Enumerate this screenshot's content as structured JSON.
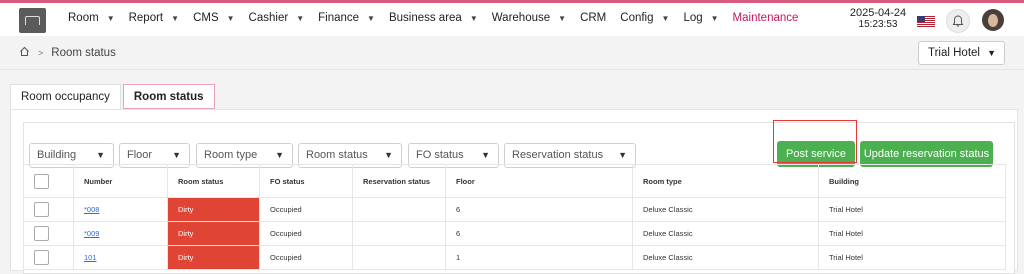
{
  "topbar": {
    "nav": [
      {
        "label": "Room",
        "dropdown": true
      },
      {
        "label": "Report",
        "dropdown": true
      },
      {
        "label": "CMS",
        "dropdown": true
      },
      {
        "label": "Cashier",
        "dropdown": true
      },
      {
        "label": "Finance",
        "dropdown": true
      },
      {
        "label": "Business area",
        "dropdown": true
      },
      {
        "label": "Warehouse",
        "dropdown": true
      },
      {
        "label": "CRM",
        "dropdown": false
      },
      {
        "label": "Config",
        "dropdown": true
      },
      {
        "label": "Log",
        "dropdown": true
      },
      {
        "label": "Maintenance",
        "dropdown": false,
        "active": true
      }
    ],
    "date": "2025-04-24",
    "time": "15:23:53",
    "accent_color": "#c2185b"
  },
  "breadcrumb": {
    "current": "Room status"
  },
  "hotel_select": {
    "value": "Trial Hotel"
  },
  "tabs": [
    {
      "label": "Room occupancy",
      "active": false
    },
    {
      "label": "Room status",
      "active": true
    }
  ],
  "filters": {
    "building": "Building",
    "floor": "Floor",
    "room_type": "Room type",
    "room_status": "Room status",
    "fo_status": "FO status",
    "reservation_status": "Reservation status"
  },
  "actions": {
    "post_service": "Post service",
    "update_reservation_status": "Update reservation status",
    "button_color": "#4caf50"
  },
  "table": {
    "headers": [
      "Number",
      "Room status",
      "FO status",
      "Reservation status",
      "Floor",
      "Room type",
      "Building"
    ],
    "rows": [
      {
        "number": "*008",
        "room_status": "Dirty",
        "fo_status": "Occupied",
        "reservation_status": "",
        "floor": "6",
        "room_type": "Deluxe Classic",
        "building": "Trial Hotel"
      },
      {
        "number": "*009",
        "room_status": "Dirty",
        "fo_status": "Occupied",
        "reservation_status": "",
        "floor": "6",
        "room_type": "Deluxe Classic",
        "building": "Trial Hotel"
      },
      {
        "number": "101",
        "room_status": "Dirty",
        "fo_status": "Occupied",
        "reservation_status": "",
        "floor": "1",
        "room_type": "Deluxe Classic",
        "building": "Trial Hotel"
      }
    ],
    "dirty_color": "#e04434"
  }
}
